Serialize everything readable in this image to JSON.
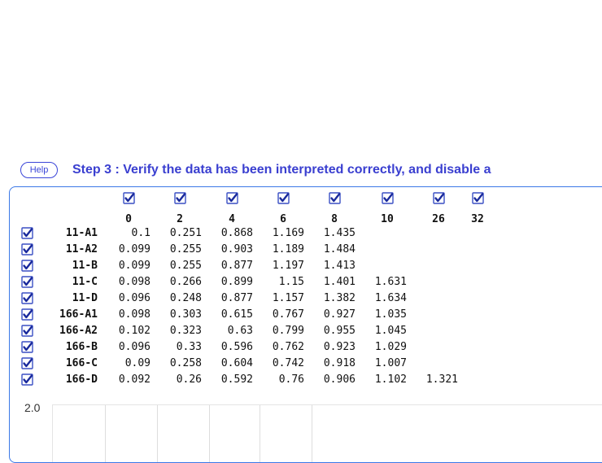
{
  "help_label": "Help",
  "step_title": "Step 3 : Verify the data has been interpreted correctly, and disable a",
  "checkbox_state": "checked",
  "columns": [
    "0",
    "2",
    "4",
    "6",
    "8",
    "10",
    "26",
    "32"
  ],
  "rows": [
    {
      "label": "11-A1",
      "values": [
        "0.1",
        "0.251",
        "0.868",
        "1.169",
        "1.435",
        "",
        ""
      ]
    },
    {
      "label": "11-A2",
      "values": [
        "0.099",
        "0.255",
        "0.903",
        "1.189",
        "1.484",
        "",
        ""
      ]
    },
    {
      "label": "11-B",
      "values": [
        "0.099",
        "0.255",
        "0.877",
        "1.197",
        "1.413",
        "",
        ""
      ]
    },
    {
      "label": "11-C",
      "values": [
        "0.098",
        "0.266",
        "0.899",
        "1.15",
        "1.401",
        "1.631",
        ""
      ]
    },
    {
      "label": "11-D",
      "values": [
        "0.096",
        "0.248",
        "0.877",
        "1.157",
        "1.382",
        "1.634",
        ""
      ]
    },
    {
      "label": "166-A1",
      "values": [
        "0.098",
        "0.303",
        "0.615",
        "0.767",
        "0.927",
        "1.035",
        ""
      ]
    },
    {
      "label": "166-A2",
      "values": [
        "0.102",
        "0.323",
        "0.63",
        "0.799",
        "0.955",
        "1.045",
        ""
      ]
    },
    {
      "label": "166-B",
      "values": [
        "0.096",
        "0.33",
        "0.596",
        "0.762",
        "0.923",
        "1.029",
        ""
      ]
    },
    {
      "label": "166-C",
      "values": [
        "0.09",
        "0.258",
        "0.604",
        "0.742",
        "0.918",
        "1.007",
        ""
      ]
    },
    {
      "label": "166-D",
      "values": [
        "0.092",
        "0.26",
        "0.592",
        "0.76",
        "0.906",
        "1.102",
        "1.321"
      ]
    }
  ],
  "plot": {
    "y_max_label": "2.0"
  }
}
